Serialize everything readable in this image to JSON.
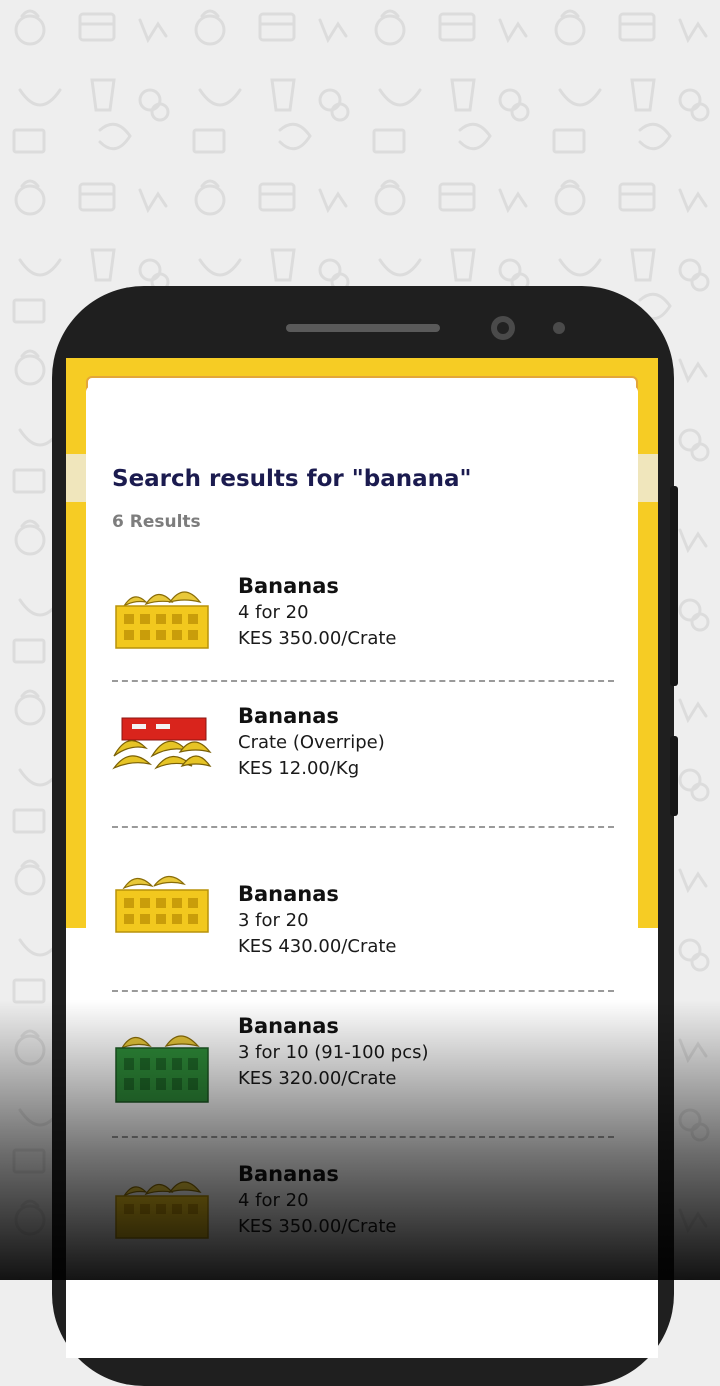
{
  "search": {
    "query": "banana",
    "clear_icon": "clear-circle-icon",
    "search_icon": "search-icon"
  },
  "results": {
    "title": "Search results for \"banana\"",
    "count_label": "6 Results"
  },
  "products": [
    {
      "name": "Bananas",
      "variant": "4 for 20",
      "price": "KES 350.00/Crate",
      "crate_color": "yellow"
    },
    {
      "name": "Bananas",
      "variant": "Crate (Overripe)",
      "price": "KES 12.00/Kg",
      "crate_color": "red"
    },
    {
      "name": "Bananas",
      "variant": "3 for 20",
      "price": "KES 430.00/Crate",
      "crate_color": "yellow"
    },
    {
      "name": "Bananas",
      "variant": "3 for 10 (91-100 pcs)",
      "price": "KES 320.00/Crate",
      "crate_color": "green"
    },
    {
      "name": "Bananas",
      "variant": "4 for 20",
      "price": "KES 350.00/Crate",
      "crate_color": "yellow"
    }
  ],
  "colors": {
    "brand_yellow": "#f6cc24",
    "search_border": "#e3a63a",
    "title_navy": "#1b1b4f",
    "phone_body": "#1f1f1f"
  }
}
